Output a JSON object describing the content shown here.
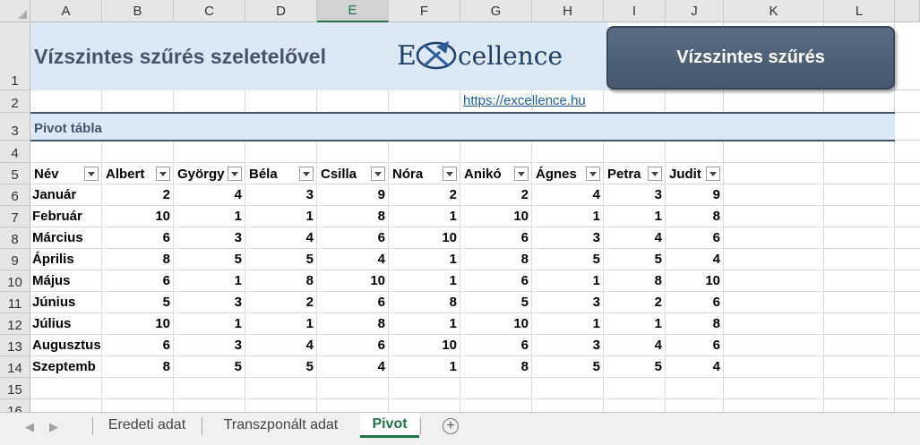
{
  "columns": [
    "A",
    "B",
    "C",
    "D",
    "E",
    "F",
    "G",
    "H",
    "I",
    "J",
    "K",
    "L"
  ],
  "rows": [
    "1",
    "2",
    "3",
    "4",
    "5",
    "6",
    "7",
    "8",
    "9",
    "10",
    "11",
    "12",
    "13",
    "14",
    "15",
    "16"
  ],
  "title": "Vízszintes szűrés szeletelővel",
  "logo": {
    "text": "Excellence"
  },
  "link": "https://excellence.hu",
  "button_label": "Vízszintes szűrés",
  "section_label": "Pivot tábla",
  "pivot": {
    "row_header": "Név",
    "names": [
      "Albert",
      "György",
      "Béla",
      "Csilla",
      "Nóra",
      "Anikó",
      "Ágnes",
      "Petra",
      "Judit"
    ],
    "months": [
      "Január",
      "Február",
      "Március",
      "Április",
      "Május",
      "Június",
      "Július",
      "Augusztus",
      "Szeptemb"
    ],
    "values": [
      [
        2,
        4,
        3,
        9,
        2,
        2,
        4,
        3,
        9
      ],
      [
        10,
        1,
        1,
        8,
        1,
        10,
        1,
        1,
        8
      ],
      [
        6,
        3,
        4,
        6,
        10,
        6,
        3,
        4,
        6
      ],
      [
        8,
        5,
        5,
        4,
        1,
        8,
        5,
        5,
        4
      ],
      [
        6,
        1,
        8,
        10,
        1,
        6,
        1,
        8,
        10
      ],
      [
        5,
        3,
        2,
        6,
        8,
        5,
        3,
        2,
        6
      ],
      [
        10,
        1,
        1,
        8,
        1,
        10,
        1,
        1,
        8
      ],
      [
        6,
        3,
        4,
        6,
        10,
        6,
        3,
        4,
        6
      ],
      [
        8,
        5,
        5,
        4,
        1,
        8,
        5,
        5,
        4
      ]
    ]
  },
  "tabs": [
    "Eredeti adat",
    "Transzponált adat",
    "Pivot"
  ],
  "active_tab": "Pivot",
  "colors": {
    "accent": "#217346",
    "band": "#dde8f5",
    "button": "#4f5f77",
    "title": "#44546a"
  }
}
